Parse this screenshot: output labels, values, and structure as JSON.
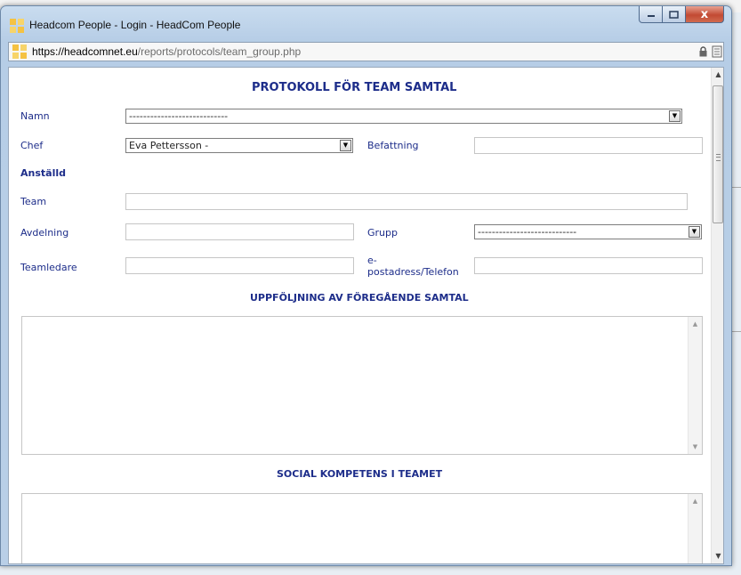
{
  "window": {
    "title": "Headcom People - Login - HeadCom People",
    "close_label": "x"
  },
  "address": {
    "domain": "https://headcomnet.eu",
    "path": "/reports/protocols/team_group.php"
  },
  "form": {
    "title": "PROTOKOLL FÖR TEAM SAMTAL",
    "namn_label": "Namn",
    "namn_value": "----------------------------",
    "chef_label": "Chef",
    "chef_value": "Eva Pettersson -",
    "befattning_label": "Befattning",
    "anstalld_heading": "Anställd",
    "team_label": "Team",
    "avdelning_label": "Avdelning",
    "grupp_label": "Grupp",
    "grupp_value": "----------------------------",
    "teamledare_label": "Teamledare",
    "epost_label_line1": "e-",
    "epost_label_line2": "postadress/Telefon",
    "section1_title": "UPPFÖLJNING AV FÖREGÅENDE SAMTAL",
    "section2_title": "SOCIAL KOMPETENS I TEAMET"
  }
}
